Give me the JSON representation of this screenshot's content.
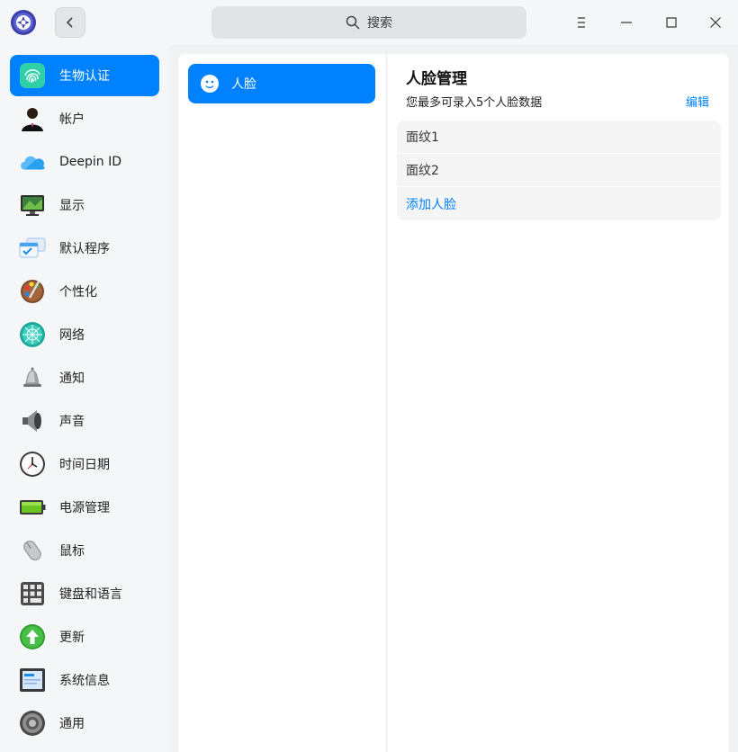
{
  "titlebar": {
    "search_placeholder": "搜索"
  },
  "sidebar": {
    "items": [
      {
        "label": "生物认证",
        "icon": "fingerprint-icon",
        "active": true
      },
      {
        "label": "帐户",
        "icon": "account-icon"
      },
      {
        "label": "Deepin ID",
        "icon": "cloud-icon"
      },
      {
        "label": "显示",
        "icon": "display-icon"
      },
      {
        "label": "默认程序",
        "icon": "default-apps-icon"
      },
      {
        "label": "个性化",
        "icon": "palette-icon"
      },
      {
        "label": "网络",
        "icon": "network-icon"
      },
      {
        "label": "通知",
        "icon": "bell-icon"
      },
      {
        "label": "声音",
        "icon": "speaker-icon"
      },
      {
        "label": "时间日期",
        "icon": "clock-icon"
      },
      {
        "label": "电源管理",
        "icon": "battery-icon"
      },
      {
        "label": "鼠标",
        "icon": "mouse-icon"
      },
      {
        "label": "键盘和语言",
        "icon": "keyboard-icon"
      },
      {
        "label": "更新",
        "icon": "update-icon"
      },
      {
        "label": "系统信息",
        "icon": "system-info-icon"
      },
      {
        "label": "通用",
        "icon": "gear-icon"
      }
    ]
  },
  "middle": {
    "face_label": "人脸"
  },
  "right": {
    "title": "人脸管理",
    "subtitle": "您最多可录入5个人脸数据",
    "edit_label": "编辑",
    "faces": [
      "面纹1",
      "面纹2"
    ],
    "add_label": "添加人脸"
  },
  "colors": {
    "accent": "#0081ff",
    "background": "#f1f2f4",
    "panel": "#ffffff"
  }
}
